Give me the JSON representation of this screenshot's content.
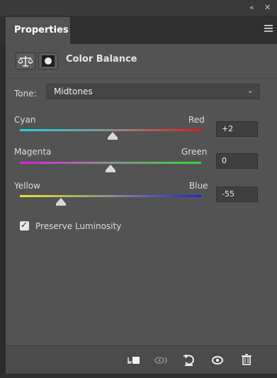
{
  "panel": {
    "collapse_glyph": "«",
    "close_glyph": "✕",
    "tab_label": "Properties",
    "header_title": "Color Balance"
  },
  "tone": {
    "label": "Tone:",
    "value": "Midtones"
  },
  "sliders": [
    {
      "left_label": "Cyan",
      "right_label": "Red",
      "value": "+2",
      "level": 0.51
    },
    {
      "left_label": "Magenta",
      "right_label": "Green",
      "value": "0",
      "level": 0.5
    },
    {
      "left_label": "Yellow",
      "right_label": "Blue",
      "value": "-55",
      "level": 0.225
    }
  ],
  "preserve_luminosity": {
    "label": "Preserve Luminosity",
    "checked": true
  },
  "footer_icons": [
    "clip-to-layer-icon",
    "view-previous-state-icon",
    "reset-icon",
    "visibility-eye-icon",
    "trash-icon"
  ]
}
